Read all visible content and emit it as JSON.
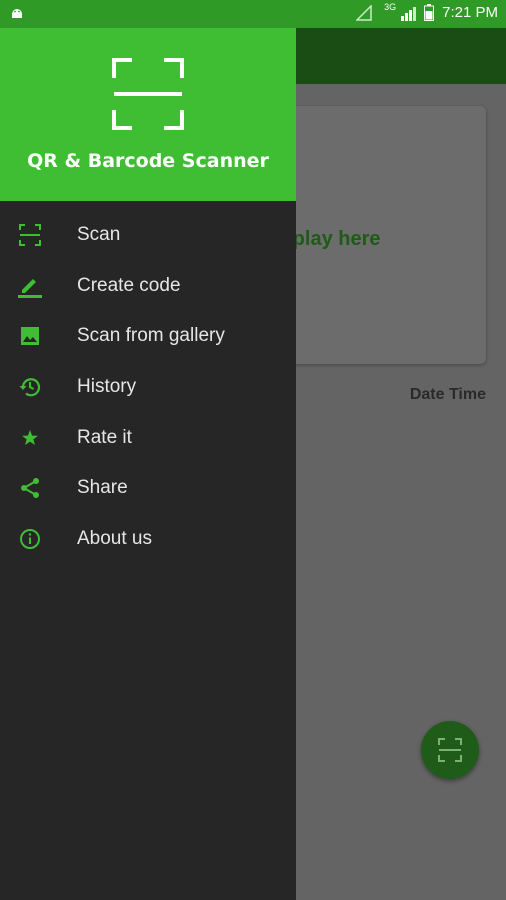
{
  "status_bar": {
    "time": "7:21 PM",
    "network": "3G"
  },
  "drawer": {
    "title": "QR & Barcode Scanner",
    "items": [
      {
        "label": "Scan",
        "icon": "scan-icon"
      },
      {
        "label": "Create code",
        "icon": "pencil-icon"
      },
      {
        "label": "Scan from gallery",
        "icon": "image-icon"
      },
      {
        "label": "History",
        "icon": "history-icon"
      },
      {
        "label": "Rate it",
        "icon": "star-icon"
      },
      {
        "label": "Share",
        "icon": "share-icon"
      },
      {
        "label": "About us",
        "icon": "info-icon"
      }
    ]
  },
  "background": {
    "card_text": "isplay here",
    "date_time_label": "Date Time"
  },
  "colors": {
    "accent": "#3fbe34",
    "status_bar": "#2f9a25",
    "drawer_bg": "#262626"
  }
}
